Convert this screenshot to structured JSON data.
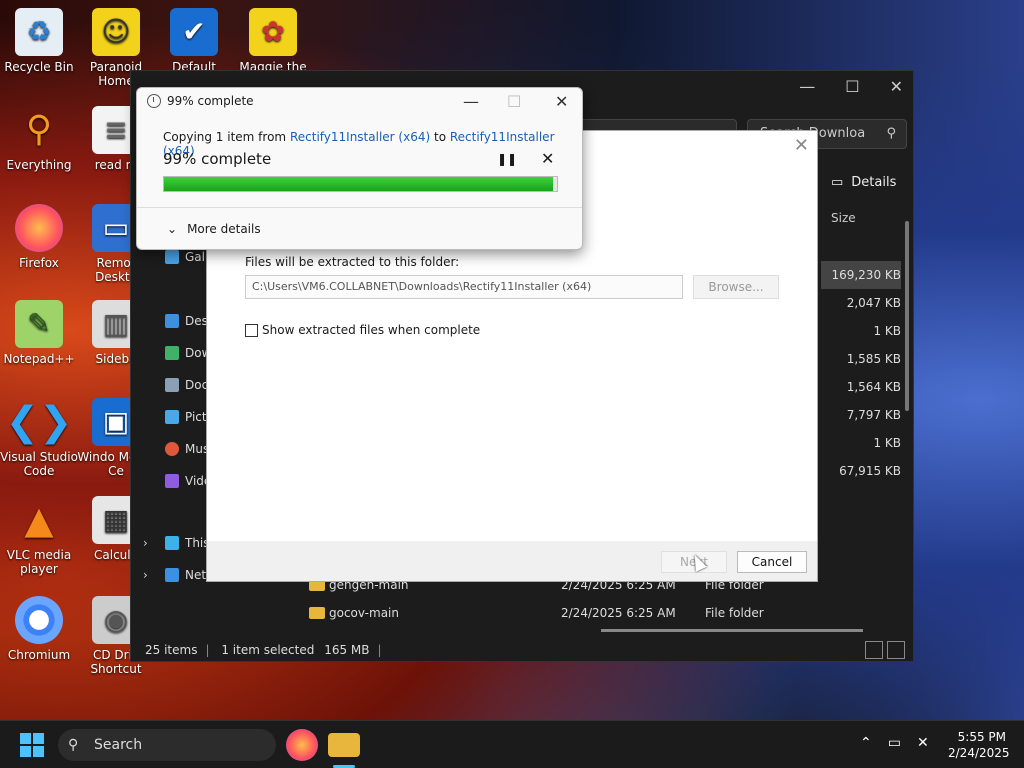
{
  "desktop_icons": [
    {
      "label": "Recycle Bin"
    },
    {
      "label": "Paranoid Home"
    },
    {
      "label": "Default"
    },
    {
      "label": "Maggie the"
    },
    {
      "label": "Everything"
    },
    {
      "label": "read m"
    },
    {
      "label": "Firefox"
    },
    {
      "label": "Remot Deskto"
    },
    {
      "label": "Notepad++"
    },
    {
      "label": "Sideba"
    },
    {
      "label": "Visual Studio Code"
    },
    {
      "label": "Windo Media Ce"
    },
    {
      "label": "VLC media player"
    },
    {
      "label": "Calcula"
    },
    {
      "label": "Chromium"
    },
    {
      "label": "CD Driv Shortcut"
    }
  ],
  "explorer": {
    "search_placeholder": "Search Downloa",
    "details_label": "Details",
    "size_header": "Size",
    "sizes": [
      "169,230 KB",
      "2,047 KB",
      "1 KB",
      "1,585 KB",
      "1,564 KB",
      "7,797 KB",
      "1 KB",
      "67,915 KB"
    ],
    "nav_items": [
      "Gall",
      "Desk",
      "Dow",
      "Doc",
      "Pict",
      "Mus",
      "Vide",
      "This",
      "Netw"
    ],
    "files": [
      {
        "name": "gengen-main",
        "date": "2/24/2025 6:25 AM",
        "type": "File folder"
      },
      {
        "name": "gocov-main",
        "date": "2/24/2025 6:25 AM",
        "type": "File folder"
      }
    ],
    "status": {
      "items": "25 items",
      "selected": "1 item selected",
      "size": "165 MB"
    }
  },
  "wizard": {
    "extract_label": "Files will be extracted to this folder:",
    "path_value": "C:\\Users\\VM6.COLLABNET\\Downloads\\Rectify11Installer (x64)",
    "browse_label": "Browse...",
    "checkbox_label": "Show extracted files when complete",
    "next_label": "Next",
    "cancel_label": "Cancel"
  },
  "copy_dialog": {
    "title": "99% complete",
    "copying_prefix": "Copying 1 item from",
    "source": "Rectify11Installer (x64)",
    "to_word": "to",
    "destination": "Rectify11Installer (x64)",
    "percent_text": "99% complete",
    "progress": 0.99,
    "more_details": "More details"
  },
  "taskbar": {
    "search_label": "Search",
    "time": "5:55 PM",
    "date": "2/24/2025"
  },
  "colors": {
    "accent": "#4cc2ff",
    "progress_green": "#16a416",
    "link": "#1a5fb4"
  }
}
